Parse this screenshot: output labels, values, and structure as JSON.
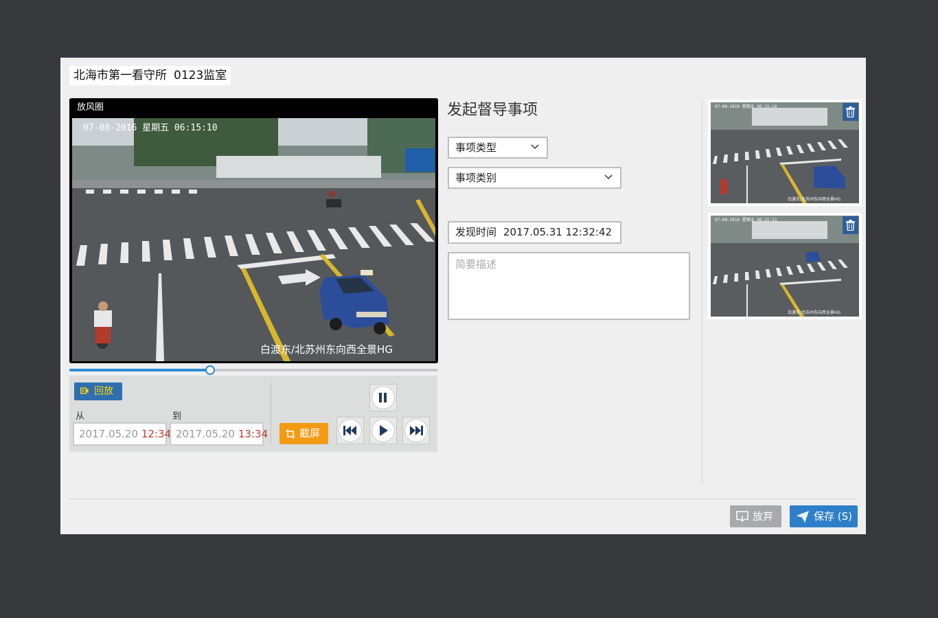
{
  "header": {
    "facility": "北海市第一看守所",
    "room": "0123监室"
  },
  "video": {
    "title": "放风圈",
    "osd_timestamp": "07-08-2016  星期五  06:15:10",
    "osd_caption": "白渡东/北苏州东向西全景HG",
    "progress_fraction": 0.38
  },
  "controls": {
    "replay_label": "回放",
    "from_label": "从",
    "to_label": "到",
    "from_date": "2017.05.20",
    "from_time": "12:34",
    "to_date": "2017.05.20",
    "to_time": "13:34",
    "capture_label": "截屏",
    "icons": [
      "camera-icon",
      "crop-icon",
      "pause-icon",
      "rewind-icon",
      "play-icon",
      "fast-forward-icon"
    ]
  },
  "form": {
    "title": "发起督导事项",
    "type_select": "事项类型",
    "category_select": "事项类别",
    "found_time_label": "发现时间",
    "found_time_value": "2017.05.31 12:32:42",
    "description_placeholder": "简要描述"
  },
  "thumbnails": [
    {
      "osd_timestamp": "07-08-2016  星期五  06:15:10",
      "osd_caption": "白渡东/北苏州东向西全景HG"
    },
    {
      "osd_timestamp": "07-08-2016  星期五  06:15:13",
      "osd_caption": "白渡东/北苏州东向西全景HG"
    }
  ],
  "footer": {
    "discard_label": "放弃",
    "save_label": "保存 (S)"
  },
  "colors": {
    "accent_blue": "#2e7fca",
    "capture_orange": "#f39a14",
    "replay_text": "#ffd800",
    "time_red": "#c0392b"
  }
}
